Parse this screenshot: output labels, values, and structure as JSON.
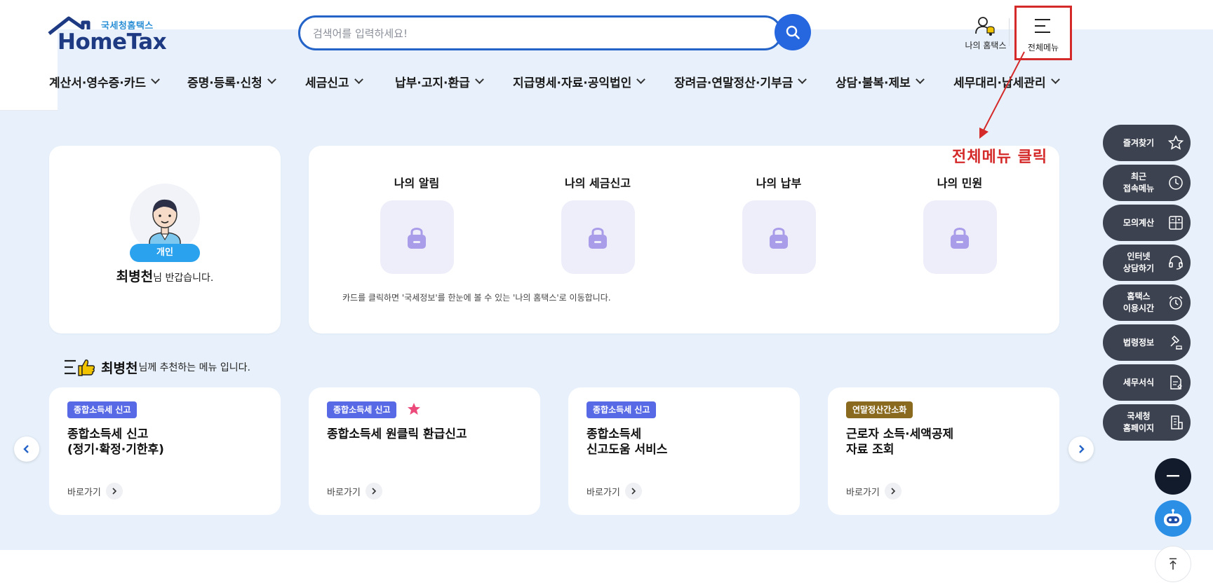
{
  "header": {
    "logo_sub": "국세청홈택스",
    "logo_main": "HomeTax",
    "search_placeholder": "검색어를 입력하세요!",
    "my_hometax_label": "나의 홈택스",
    "all_menu_label": "전체메뉴"
  },
  "gnb": [
    {
      "label": "계산서·영수증·카드"
    },
    {
      "label": "증명·등록·신청"
    },
    {
      "label": "세금신고"
    },
    {
      "label": "납부·고지·환급"
    },
    {
      "label": "지급명세·자료·공익법인"
    },
    {
      "label": "장려금·연말정산·기부금"
    },
    {
      "label": "상담·불복·제보"
    },
    {
      "label": "세무대리·납세관리"
    }
  ],
  "annotation": {
    "text": "전체메뉴 클릭",
    "color": "#d42a2a"
  },
  "profile": {
    "badge": "개인",
    "name": "최병천",
    "greeting_suffix": "님 반갑습니다."
  },
  "my_cards": {
    "items": [
      {
        "title": "나의 알림"
      },
      {
        "title": "나의 세금신고"
      },
      {
        "title": "나의 납부"
      },
      {
        "title": "나의 민원"
      }
    ],
    "note": "카드를 클릭하면 '국세정보'를 한눈에 볼 수 있는 '나의 홈택스'로 이동합니다."
  },
  "recommend": {
    "name": "최병천",
    "suffix": "님께 추천하는 메뉴 입니다.",
    "cards": [
      {
        "tag": "종합소득세 신고",
        "title": "종합소득세 신고\n(정기·확정·기한후)",
        "link": "바로가기"
      },
      {
        "tag": "종합소득세 신고",
        "title": "종합소득세 원클릭 환급신고",
        "link": "바로가기"
      },
      {
        "tag": "종합소득세 신고",
        "title": "종합소득세\n신고도움 서비스",
        "link": "바로가기"
      },
      {
        "tag": "연말정산간소화",
        "title": "근로자 소득·세액공제\n자료 조회",
        "link": "바로가기"
      }
    ]
  },
  "quick_menu": [
    {
      "label": "즐겨찾기",
      "icon": "star-icon"
    },
    {
      "label": "최근\n접속메뉴",
      "icon": "clock-icon"
    },
    {
      "label": "모의계산",
      "icon": "calculator-icon"
    },
    {
      "label": "인터넷\n상담하기",
      "icon": "headset-icon"
    },
    {
      "label": "홈택스\n이용시간",
      "icon": "alarm-icon"
    },
    {
      "label": "법령정보",
      "icon": "gavel-icon"
    },
    {
      "label": "세무서식",
      "icon": "document-icon"
    },
    {
      "label": "국세청\n홈페이지",
      "icon": "building-icon"
    }
  ],
  "colors": {
    "brand_navy": "#1d3a82",
    "search_blue": "#2667e0",
    "bg_light_blue": "#e8f1fb",
    "quick_menu_dark": "#3c4250",
    "tag_blue": "#5869e6",
    "tag_brown": "#8a6a1e",
    "chatbot_blue": "#2b8fe6"
  }
}
